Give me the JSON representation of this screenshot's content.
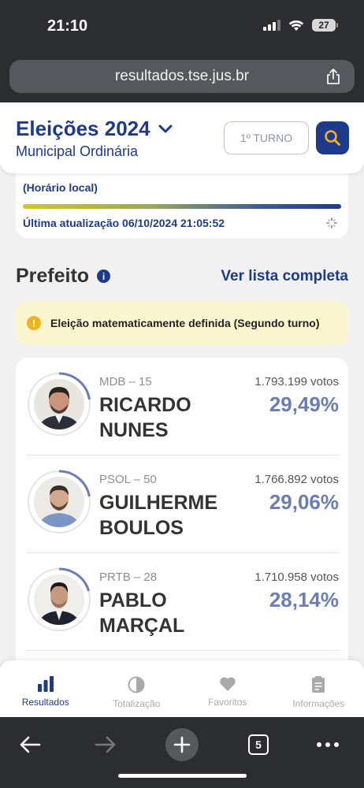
{
  "status_bar": {
    "time": "21:10",
    "battery": "27"
  },
  "browser": {
    "url": "resultados.tse.jus.br",
    "tabs_count": "5"
  },
  "header": {
    "title": "Eleições 2024",
    "subtitle": "Municipal Ordinária",
    "turno_label": "1º TURNO"
  },
  "update": {
    "horario": "(Horário local)",
    "last_update": "Última atualização 06/10/2024 21:05:52"
  },
  "section": {
    "title": "Prefeito",
    "info_icon": "i",
    "link": "Ver lista completa"
  },
  "alert": {
    "icon": "!",
    "text": "Eleição matematicamente definida (Segundo turno)"
  },
  "candidates": [
    {
      "party": "MDB – 15",
      "name": "RICARDO NUNES",
      "votes": "1.793.199 votos",
      "percent": "29,49%"
    },
    {
      "party": "PSOL – 50",
      "name": "GUILHERME BOULOS",
      "votes": "1.766.892 votos",
      "percent": "29,06%"
    },
    {
      "party": "PRTB – 28",
      "name": "PABLO MARÇAL",
      "votes": "1.710.958 votos",
      "percent": "28,14%"
    }
  ],
  "tabbar": [
    {
      "label": "Resultados",
      "icon": "bar-chart-icon",
      "active": true
    },
    {
      "label": "Totalização",
      "icon": "pie-chart-icon",
      "active": false
    },
    {
      "label": "Favoritos",
      "icon": "heart-icon",
      "active": false
    },
    {
      "label": "Informações",
      "icon": "document-icon",
      "active": false
    }
  ],
  "colors": {
    "primary": "#1e3a8a",
    "percent": "#6b7db3",
    "alert_bg": "#fbf6cf",
    "alert_icon": "#f2b21c"
  }
}
